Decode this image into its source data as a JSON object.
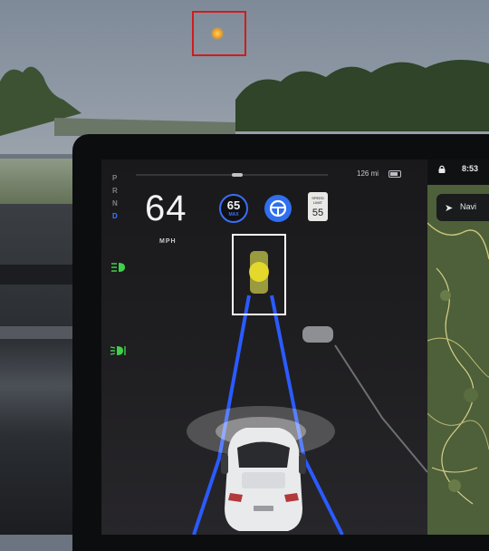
{
  "gear_selector": {
    "items": [
      "P",
      "R",
      "N",
      "D"
    ],
    "active": "D"
  },
  "status_bar": {
    "range_text": "126 mi",
    "clock_text": "8:53"
  },
  "speedometer": {
    "speed": "64",
    "unit": "MPH"
  },
  "set_speed": {
    "value": "65",
    "label": "MAX"
  },
  "speed_limit_sign": {
    "header": "SPEED LIMIT",
    "value": "55"
  },
  "navigation": {
    "button_label": "Navi"
  },
  "colors": {
    "autopilot_blue": "#2f6ff0",
    "lane_blue": "#2a5bff",
    "indicator_green": "#3fd14a",
    "highlight_red": "#d01c1c",
    "highlight_white": "#ffffff",
    "detected_light_yellow": "#f2e32a"
  },
  "icons": [
    "lock-icon",
    "battery-icon",
    "steering-wheel-icon",
    "headlight-icon",
    "fog-light-icon",
    "navigate-arrow-icon"
  ]
}
